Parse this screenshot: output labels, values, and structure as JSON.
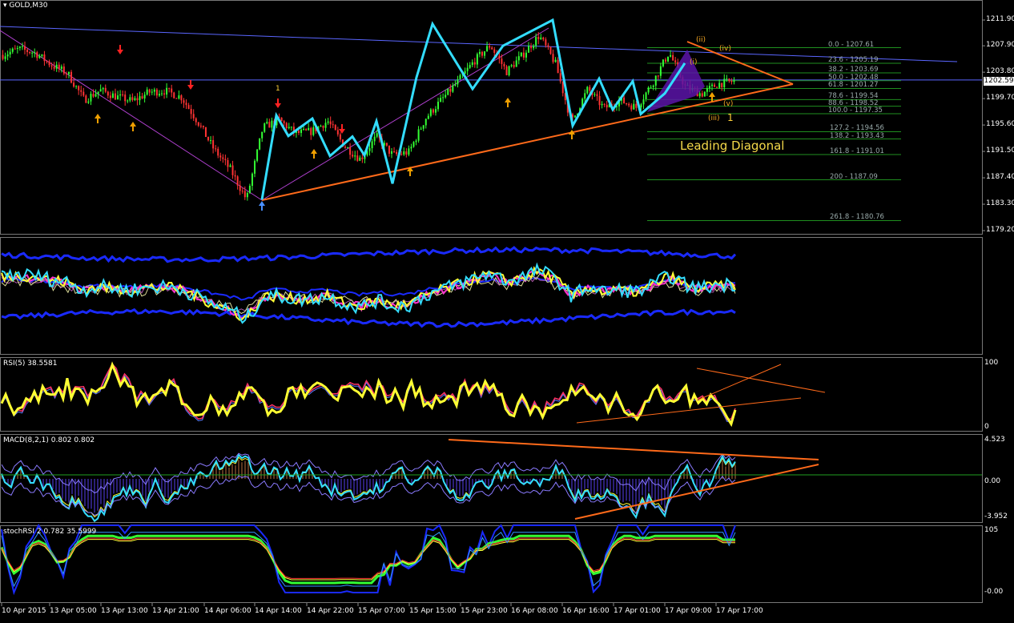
{
  "symbol": "GOLD,M30",
  "colors": {
    "background": "#000000",
    "bull": "#33ff33",
    "bear": "#ff3333",
    "wave": "#33ddff",
    "trendline": "#ff6a1a",
    "grid": "#333333"
  },
  "price_axis": [
    "1211.90",
    "1207.90",
    "1203.80",
    "1199.70",
    "1195.60",
    "1191.50",
    "1187.40",
    "1183.30",
    "1179.20"
  ],
  "current_price": "1202.59",
  "rsi_label": "RSI(5) 38.5581",
  "rsi_axis": [
    "100",
    "0"
  ],
  "macd_label": "MACD(8,2,1) 0.802 0.802",
  "macd_axis": [
    "4.523",
    "0.00",
    "-3.952"
  ],
  "stoch_label": "stochRSI 2 0.782 35.5999",
  "stoch_axis": [
    "105",
    "-0.00"
  ],
  "time_axis": [
    "10 Apr 2015",
    "13 Apr 05:00",
    "13 Apr 13:00",
    "13 Apr 21:00",
    "14 Apr 06:00",
    "14 Apr 14:00",
    "14 Apr 22:00",
    "15 Apr 07:00",
    "15 Apr 15:00",
    "15 Apr 23:00",
    "16 Apr 08:00",
    "16 Apr 16:00",
    "17 Apr 01:00",
    "17 Apr 09:00",
    "17 Apr 17:00"
  ],
  "fib_levels": [
    {
      "label": "0.0 - 1207.61"
    },
    {
      "label": "23.6 - 1205.19"
    },
    {
      "label": "38.2 - 1203.69"
    },
    {
      "label": "50.0 - 1202.48"
    },
    {
      "label": "61.8 - 1201.27"
    },
    {
      "label": "78.6 - 1199.54"
    },
    {
      "label": "88.6 - 1198.52"
    },
    {
      "label": "100.0 - 1197.35"
    },
    {
      "label": "127.2 - 1194.56"
    },
    {
      "label": "138.2 - 1193.43"
    },
    {
      "label": "161.8 - 1191.01"
    },
    {
      "label": "200 - 1187.09"
    },
    {
      "label": "261.8 - 1180.76"
    }
  ],
  "annotations": {
    "leading_diagonal": "Leading Diagonal",
    "wave_1_top": "1",
    "wave_1_bottom": "1",
    "wave_i": "(i)",
    "wave_ii": "(ii)",
    "wave_iii": "(iii)",
    "wave_iv": "(iv)",
    "wave_v": "(v)"
  },
  "chart_data": {
    "type": "candlestick",
    "title": "GOLD,M30",
    "ylim": [
      1179.2,
      1211.9
    ],
    "x_categories": [
      "10 Apr 2015",
      "13 Apr 05:00",
      "13 Apr 13:00",
      "13 Apr 21:00",
      "14 Apr 06:00",
      "14 Apr 14:00",
      "14 Apr 22:00",
      "15 Apr 07:00",
      "15 Apr 15:00",
      "15 Apr 23:00",
      "16 Apr 08:00",
      "16 Apr 16:00",
      "17 Apr 01:00",
      "17 Apr 09:00",
      "17 Apr 17:00"
    ],
    "close_path": [
      1206.5,
      1207.4,
      1206.8,
      1204.9,
      1203.6,
      1199.5,
      1201.0,
      1200.0,
      1199.3,
      1200.7,
      1200.9,
      1199.9,
      1196.1,
      1191.8,
      1188.7,
      1184.0,
      1195.2,
      1196.4,
      1194.3,
      1194.6,
      1196.2,
      1192.4,
      1190.3,
      1193.8,
      1190.9,
      1191.4,
      1196.6,
      1199.5,
      1202.3,
      1205.5,
      1208.0,
      1203.9,
      1206.5,
      1209.5,
      1205.2,
      1196.0,
      1201.2,
      1198.2,
      1199.4,
      1198.3,
      1202.2,
      1206.9,
      1201.5,
      1200.4,
      1202.0,
      1202.4
    ],
    "wave_path": [
      1184.0,
      1197.1,
      1193.9,
      1196.6,
      1190.8,
      1193.8,
      1190.9,
      1196.2,
      1186.5,
      1203.0,
      1211.3,
      1201.2,
      1207.9,
      1211.9,
      1195.5,
      1202.8,
      1198.0,
      1202.4,
      1197.3,
      1200.5,
      1205.2
    ],
    "fib_values": [
      1207.61,
      1205.19,
      1203.69,
      1202.48,
      1201.27,
      1199.54,
      1198.52,
      1197.35,
      1194.56,
      1193.43,
      1191.01,
      1187.09,
      1180.76
    ],
    "indicators": {
      "rsi": {
        "label": "RSI(5) 38.5581",
        "ylim": [
          0,
          100
        ],
        "last": 38.5581
      },
      "macd": {
        "label": "MACD(8,2,1) 0.802 0.802",
        "ylim": [
          -3.952,
          4.523
        ],
        "last": 0.802
      },
      "stoch_rsi": {
        "label": "stochRSI 2 0.782 35.5999",
        "ylim": [
          0,
          105
        ]
      }
    }
  }
}
